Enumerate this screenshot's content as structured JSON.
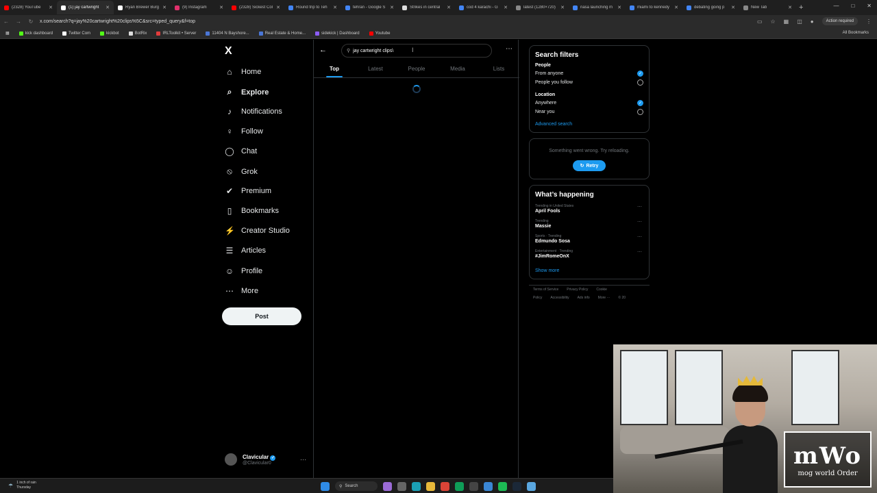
{
  "browser": {
    "tabs": [
      {
        "label": "(2328) YouTube",
        "color": "#ff0000"
      },
      {
        "label": "(1) jay cartwright",
        "color": "#ffffff",
        "active": true
      },
      {
        "label": "Ryan Brewer Burg",
        "color": "#ffffff"
      },
      {
        "label": "(9) Instagram",
        "color": "#e1306c"
      },
      {
        "label": "(2328) Sickest Col",
        "color": "#ff0000"
      },
      {
        "label": "Round trip to Teh",
        "color": "#4285f4"
      },
      {
        "label": "tehran - Google S",
        "color": "#4285f4"
      },
      {
        "label": "Strikes in central",
        "color": "#dddddd"
      },
      {
        "label": "cod 4 karachi - G",
        "color": "#4285f4"
      },
      {
        "label": "latest (1280×720)",
        "color": "#888888"
      },
      {
        "label": "nasa launching m",
        "color": "#4285f4"
      },
      {
        "label": "miami to kennedy",
        "color": "#4285f4"
      },
      {
        "label": "debating going p",
        "color": "#4285f4"
      },
      {
        "label": "New Tab",
        "color": "#888888"
      }
    ],
    "url": "x.com/search?q=jay%20cartwright%20clips%5C&src=typed_query&f=top",
    "action_required": "Action required",
    "bookmarks": [
      {
        "label": "kick dashboard",
        "color": "#53fc18"
      },
      {
        "label": "Twitter Com",
        "color": "#ffffff"
      },
      {
        "label": "kickbot",
        "color": "#53fc18"
      },
      {
        "label": "BotRix",
        "color": "#dddddd"
      },
      {
        "label": "IRLToolkit • Server",
        "color": "#e23c3c"
      },
      {
        "label": "11404 N Bayshore...",
        "color": "#4a76d6"
      },
      {
        "label": "Real Estate & Home...",
        "color": "#4a76d6"
      },
      {
        "label": "sidekick | Dashboard",
        "color": "#8b5cf6"
      },
      {
        "label": "Youtube",
        "color": "#ff0000"
      }
    ],
    "all_bookmarks": "All Bookmarks"
  },
  "sidebar": {
    "logo": "X",
    "items": [
      {
        "label": "Home",
        "icon": "home-icon",
        "glyph": "⌂"
      },
      {
        "label": "Explore",
        "icon": "search-icon",
        "glyph": "⌕"
      },
      {
        "label": "Notifications",
        "icon": "bell-icon",
        "glyph": "♪"
      },
      {
        "label": "Follow",
        "icon": "add-user-icon",
        "glyph": "♀"
      },
      {
        "label": "Chat",
        "icon": "chat-icon",
        "glyph": "◯"
      },
      {
        "label": "Grok",
        "icon": "grok-icon",
        "glyph": "⦸"
      },
      {
        "label": "Premium",
        "icon": "premium-icon",
        "glyph": "✔"
      },
      {
        "label": "Bookmarks",
        "icon": "bookmark-icon",
        "glyph": "▯"
      },
      {
        "label": "Creator Studio",
        "icon": "creator-studio-icon",
        "glyph": "⚡"
      },
      {
        "label": "Articles",
        "icon": "articles-icon",
        "glyph": "☰"
      },
      {
        "label": "Profile",
        "icon": "profile-icon",
        "glyph": "☺"
      },
      {
        "label": "More",
        "icon": "more-icon",
        "glyph": "⋯"
      }
    ],
    "post_label": "Post",
    "account": {
      "name": "Clavicular",
      "handle": "@Clavicular0"
    }
  },
  "search": {
    "query": "jay cartwright clips\\",
    "tabs": [
      "Top",
      "Latest",
      "People",
      "Media",
      "Lists"
    ],
    "active_tab": "Top"
  },
  "filters": {
    "title": "Search filters",
    "people_heading": "People",
    "people_options": [
      {
        "label": "From anyone",
        "selected": true
      },
      {
        "label": "People you follow",
        "selected": false
      }
    ],
    "location_heading": "Location",
    "location_options": [
      {
        "label": "Anywhere",
        "selected": true
      },
      {
        "label": "Near you",
        "selected": false
      }
    ],
    "advanced_label": "Advanced search"
  },
  "error_card": {
    "message": "Something went wrong. Try reloading.",
    "retry_label": "Retry"
  },
  "trends": {
    "title": "What’s happening",
    "items": [
      {
        "context": "Trending in United States",
        "name": "April Fools"
      },
      {
        "context": "Trending",
        "name": "Massie"
      },
      {
        "context": "Sports · Trending",
        "name": "Edmundo Sosa"
      },
      {
        "context": "Entertainment · Trending",
        "name": "#JimRomeOnX"
      }
    ],
    "show_more": "Show more"
  },
  "footer": {
    "links": [
      "Terms of Service",
      "Privacy Policy",
      "Cookie Policy",
      "Accessibility",
      "Ads info",
      "More ···",
      "© 20"
    ]
  },
  "overlay": {
    "logo_big": "mWo",
    "logo_small": "mog world Order"
  },
  "taskbar": {
    "weather_line1": "1 inch of rain",
    "weather_line2": "Thursday",
    "search_label": "Search"
  }
}
